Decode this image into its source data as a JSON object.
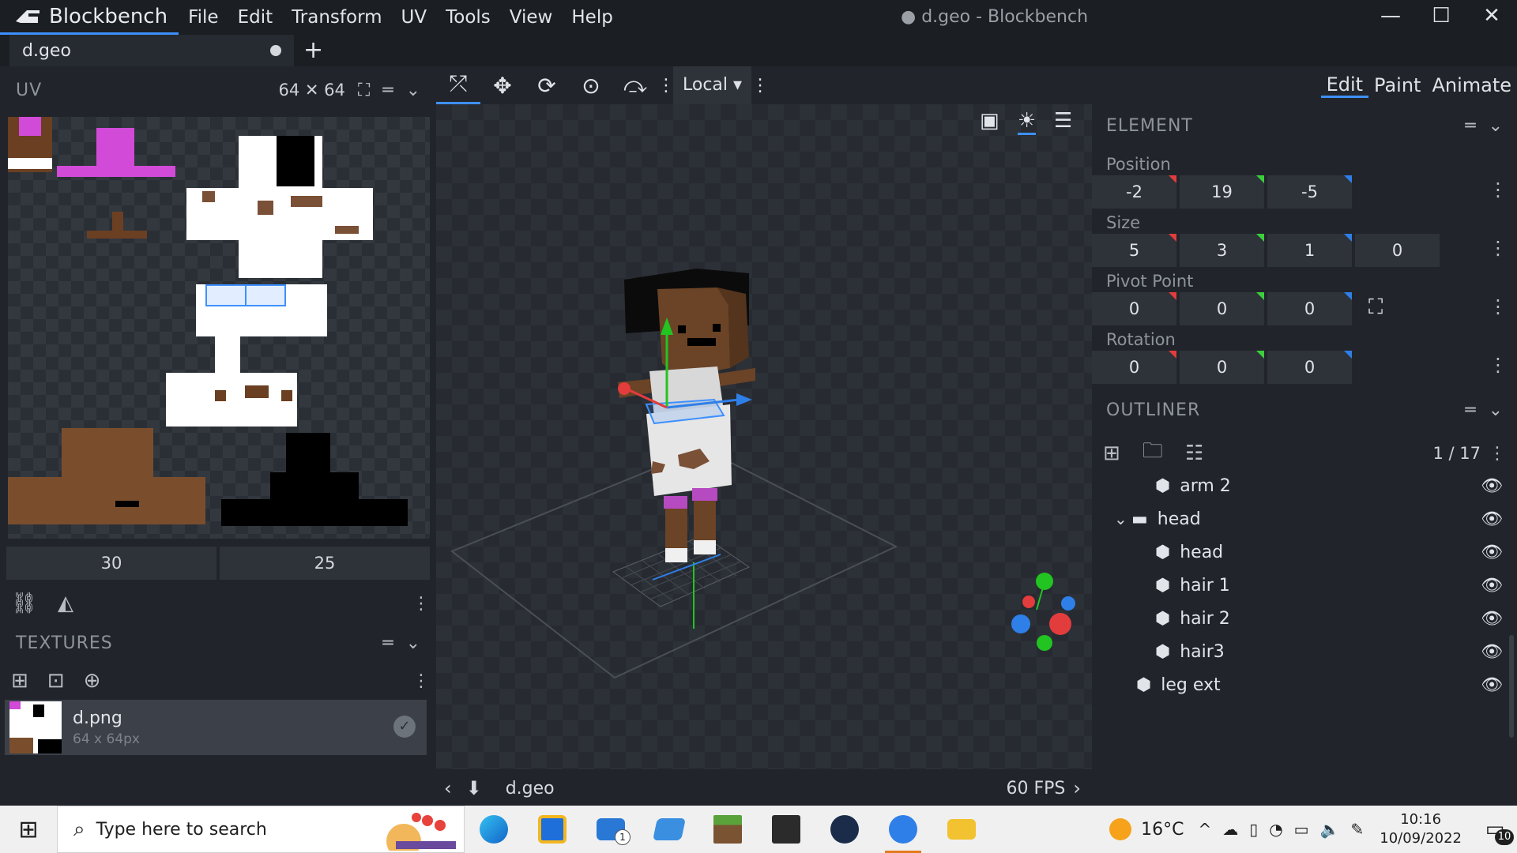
{
  "app": {
    "name": "Blockbench",
    "window_title": "● d.geo - Blockbench",
    "menu": [
      "File",
      "Edit",
      "Transform",
      "UV",
      "Tools",
      "View",
      "Help"
    ],
    "tab": {
      "name": "d.geo",
      "new_tab": "+"
    }
  },
  "uv_panel": {
    "title": "UV",
    "size_label": "64 ✕ 64",
    "fields": [
      "30",
      "25"
    ]
  },
  "textures_panel": {
    "title": "TEXTURES",
    "item": {
      "name": "d.png",
      "size": "64 x 64px"
    }
  },
  "viewport": {
    "mode_select": "Local",
    "footer_name": "d.geo",
    "fps": "60 FPS"
  },
  "modes": [
    "Edit",
    "Paint",
    "Animate"
  ],
  "element_panel": {
    "title": "ELEMENT",
    "position": {
      "label": "Position",
      "values": [
        "-2",
        "19",
        "-5"
      ]
    },
    "size": {
      "label": "Size",
      "values": [
        "5",
        "3",
        "1",
        "0"
      ]
    },
    "pivot": {
      "label": "Pivot Point",
      "values": [
        "0",
        "0",
        "0"
      ]
    },
    "rotation": {
      "label": "Rotation",
      "values": [
        "0",
        "0",
        "0"
      ]
    },
    "axis_colors": [
      "#e33c3c",
      "#3ccf3c",
      "#2f7fe8",
      "#2e333a"
    ]
  },
  "outliner": {
    "title": "OUTLINER",
    "count": "1 / 17",
    "items": [
      {
        "label": "arm 2",
        "type": "cube",
        "depth": 2
      },
      {
        "label": "head",
        "type": "folder",
        "depth": 1
      },
      {
        "label": "head",
        "type": "cube",
        "depth": 2
      },
      {
        "label": "hair 1",
        "type": "cube",
        "depth": 2
      },
      {
        "label": "hair 2",
        "type": "cube",
        "depth": 2
      },
      {
        "label": "hair3",
        "type": "cube",
        "depth": 2
      },
      {
        "label": "leg ext",
        "type": "cube",
        "depth": 1
      }
    ]
  },
  "taskbar": {
    "search_placeholder": "Type here to search",
    "temperature": "16°C",
    "time": "10:16",
    "date": "10/09/2022",
    "notification_count": "10",
    "mail_badge": "1"
  }
}
